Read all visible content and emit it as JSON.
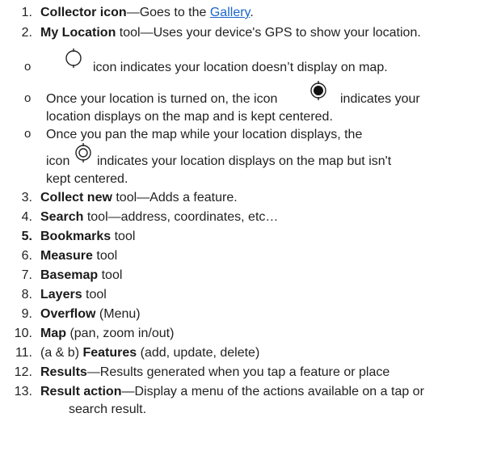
{
  "items": [
    {
      "num": "1.",
      "bold": "Collector icon",
      "rest": "—Goes to the ",
      "link": "Gallery",
      "tail": "."
    },
    {
      "num": "2.",
      "bold": "My Location",
      "rest": " tool—Uses your device's GPS to show your location."
    },
    {
      "num": "3.",
      "bold": "Collect new",
      "rest": " tool—Adds a feature."
    },
    {
      "num": "4.",
      "bold": "Search",
      "rest": " tool—address, coordinates, etc…"
    },
    {
      "num": "5.",
      "bold": "Bookmarks",
      "rest": " tool"
    },
    {
      "num": "6.",
      "bold": "Measure",
      "rest": " tool"
    },
    {
      "num": "7.",
      "bold": "Basemap",
      "rest": " tool"
    },
    {
      "num": "8.",
      "bold": "Layers",
      "rest": " tool"
    },
    {
      "num": "9.",
      "bold": "Overflow",
      "rest": " (Menu)"
    },
    {
      "num": "10.",
      "bold": "Map",
      "rest": " (pan, zoom in/out)"
    },
    {
      "num": "11.",
      "pre": "(a & b) ",
      "bold": "Features",
      "rest": " (add, update, delete)"
    },
    {
      "num": "12.",
      "bold": "Results",
      "rest": "—Results generated when you tap a feature or place"
    },
    {
      "num": "13.",
      "bold": "Result action",
      "rest": "—Display a menu of the actions available on a tap or",
      "cont": "search result."
    }
  ],
  "sub": {
    "bullet": "o",
    "a": "icon indicates your location doesn’t display on map.",
    "b1_pre": "Once your location is turned on, the icon",
    "b1_post": "indicates your",
    "b2": "location displays on the map and is kept centered.",
    "c1": "Once you pan the map while your location displays, the",
    "c2_pre": "icon",
    "c2_post": "indicates your location displays on the map but isn't",
    "c3": "kept centered."
  },
  "icons": {
    "off": "location-off-icon",
    "centered": "location-centered-icon",
    "not_centered": "location-not-centered-icon"
  }
}
